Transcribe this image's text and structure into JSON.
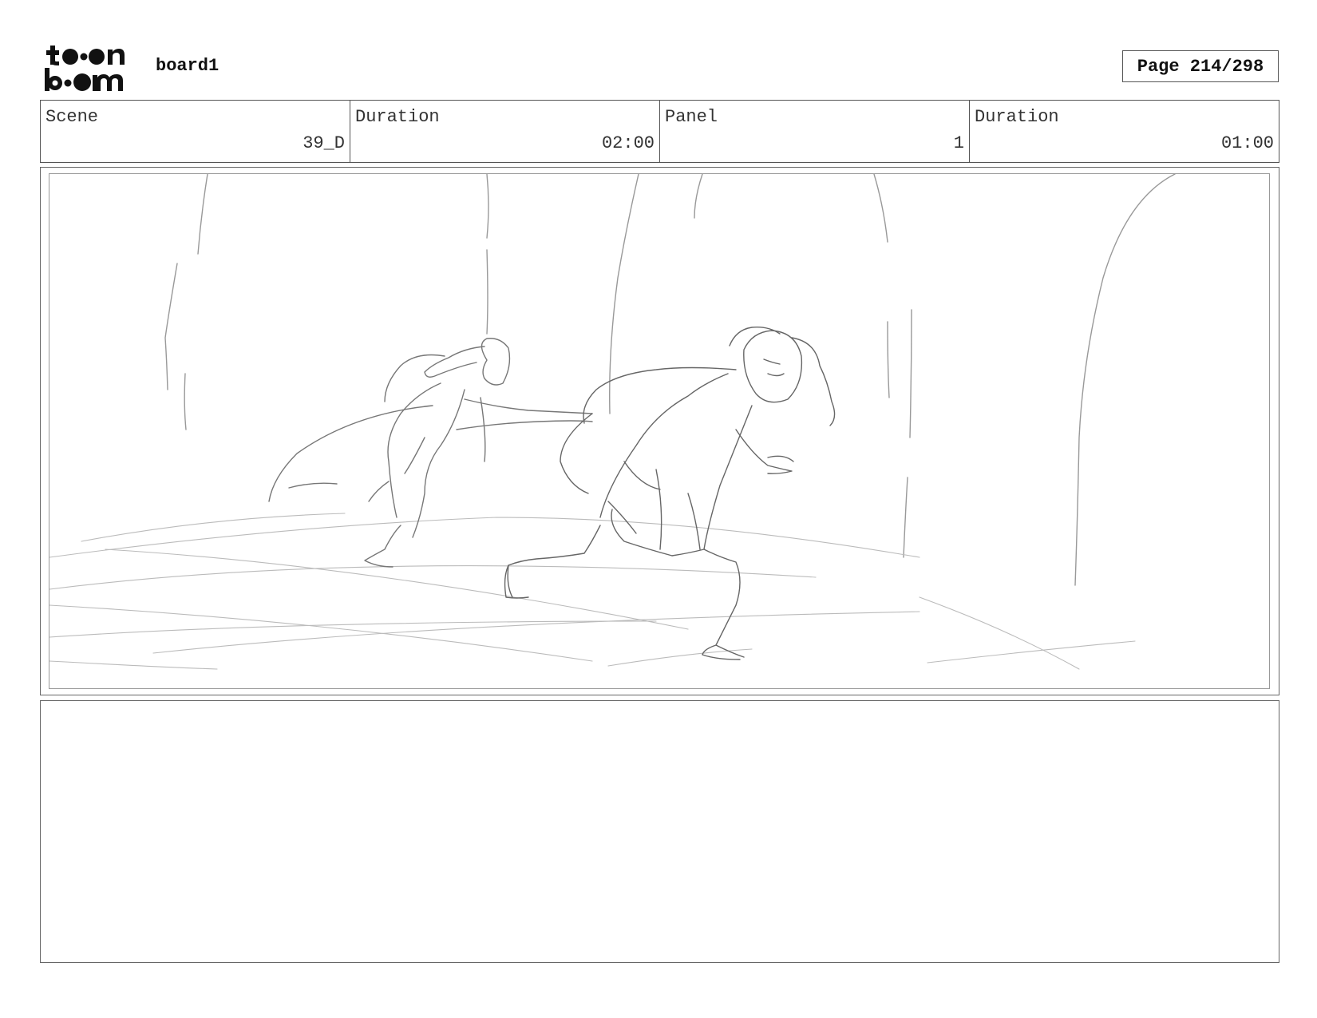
{
  "header": {
    "logo_text_top": "toon",
    "logo_text_bottom": "boom",
    "project_name": "board1",
    "page_label": "Page 214/298"
  },
  "info": [
    {
      "label": "Scene",
      "value": "39_D"
    },
    {
      "label": "Duration",
      "value": "02:00"
    },
    {
      "label": "Panel",
      "value": "1"
    },
    {
      "label": "Duration",
      "value": "01:00"
    }
  ],
  "notes": {
    "text": ""
  }
}
